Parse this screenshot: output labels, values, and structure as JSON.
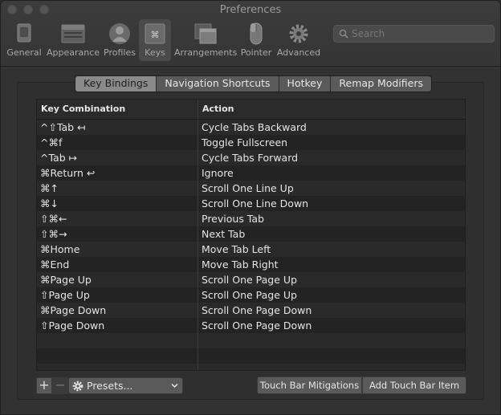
{
  "window": {
    "title": "Preferences"
  },
  "toolbar": {
    "items": [
      {
        "label": "General",
        "icon": "general-icon"
      },
      {
        "label": "Appearance",
        "icon": "appearance-icon"
      },
      {
        "label": "Profiles",
        "icon": "profiles-icon"
      },
      {
        "label": "Keys",
        "icon": "keys-icon",
        "selected": true
      },
      {
        "label": "Arrangements",
        "icon": "arrangements-icon"
      },
      {
        "label": "Pointer",
        "icon": "pointer-icon"
      },
      {
        "label": "Advanced",
        "icon": "advanced-icon"
      }
    ],
    "search_placeholder": "Search"
  },
  "tabs": [
    {
      "label": "Key Bindings",
      "active": true
    },
    {
      "label": "Navigation Shortcuts",
      "active": false
    },
    {
      "label": "Hotkey",
      "active": false
    },
    {
      "label": "Remap Modifiers",
      "active": false
    }
  ],
  "table": {
    "columns": [
      "Key Combination",
      "Action"
    ],
    "rows": [
      [
        "^⇧Tab ↤",
        "Cycle Tabs Backward"
      ],
      [
        "^⌘f",
        "Toggle Fullscreen"
      ],
      [
        "^Tab ↦",
        "Cycle Tabs Forward"
      ],
      [
        "⌘Return ↩",
        "Ignore"
      ],
      [
        "⌘↑",
        "Scroll One Line Up"
      ],
      [
        "⌘↓",
        "Scroll One Line Down"
      ],
      [
        "⇧⌘←",
        "Previous Tab"
      ],
      [
        "⇧⌘→",
        "Next Tab"
      ],
      [
        "⌘Home",
        "Move Tab Left"
      ],
      [
        "⌘End",
        "Move Tab Right"
      ],
      [
        "⌘Page Up",
        "Scroll One Page Up"
      ],
      [
        "⇧Page Up",
        "Scroll One Page Up"
      ],
      [
        "⌘Page Down",
        "Scroll One Page Down"
      ],
      [
        "⇧Page Down",
        "Scroll One Page Down"
      ],
      [
        "",
        ""
      ],
      [
        "",
        ""
      ],
      [
        "",
        ""
      ]
    ]
  },
  "bottom": {
    "add_label": "+",
    "remove_label": "−",
    "presets_label": "Presets...",
    "touchbar_mitigations_label": "Touch Bar Mitigations",
    "add_touchbar_item_label": "Add Touch Bar Item"
  },
  "colors": {
    "window_bg": "#323232",
    "selected_tab_bg": "#8a8a8a",
    "table_row_alt": "#2a2a2a"
  }
}
